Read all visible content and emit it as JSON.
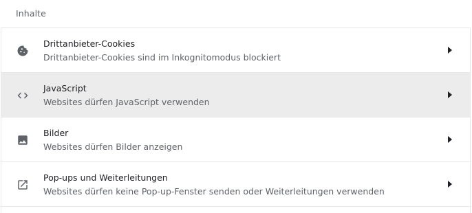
{
  "section": {
    "title": "Inhalte"
  },
  "items": [
    {
      "title": "Drittanbieter-Cookies",
      "subtitle": "Drittanbieter-Cookies sind im Inkognitomodus blockiert",
      "icon": "cookie-icon"
    },
    {
      "title": "JavaScript",
      "subtitle": "Websites dürfen JavaScript verwenden",
      "icon": "code-icon"
    },
    {
      "title": "Bilder",
      "subtitle": "Websites dürfen Bilder anzeigen",
      "icon": "image-icon"
    },
    {
      "title": "Pop-ups und Weiterleitungen",
      "subtitle": "Websites dürfen keine Pop-up-Fenster senden oder Weiterleitungen verwenden",
      "icon": "open-in-new-icon"
    }
  ],
  "colors": {
    "icon": "#5f6368",
    "hover_row": "#ececec",
    "divider": "#e8e8e8"
  }
}
